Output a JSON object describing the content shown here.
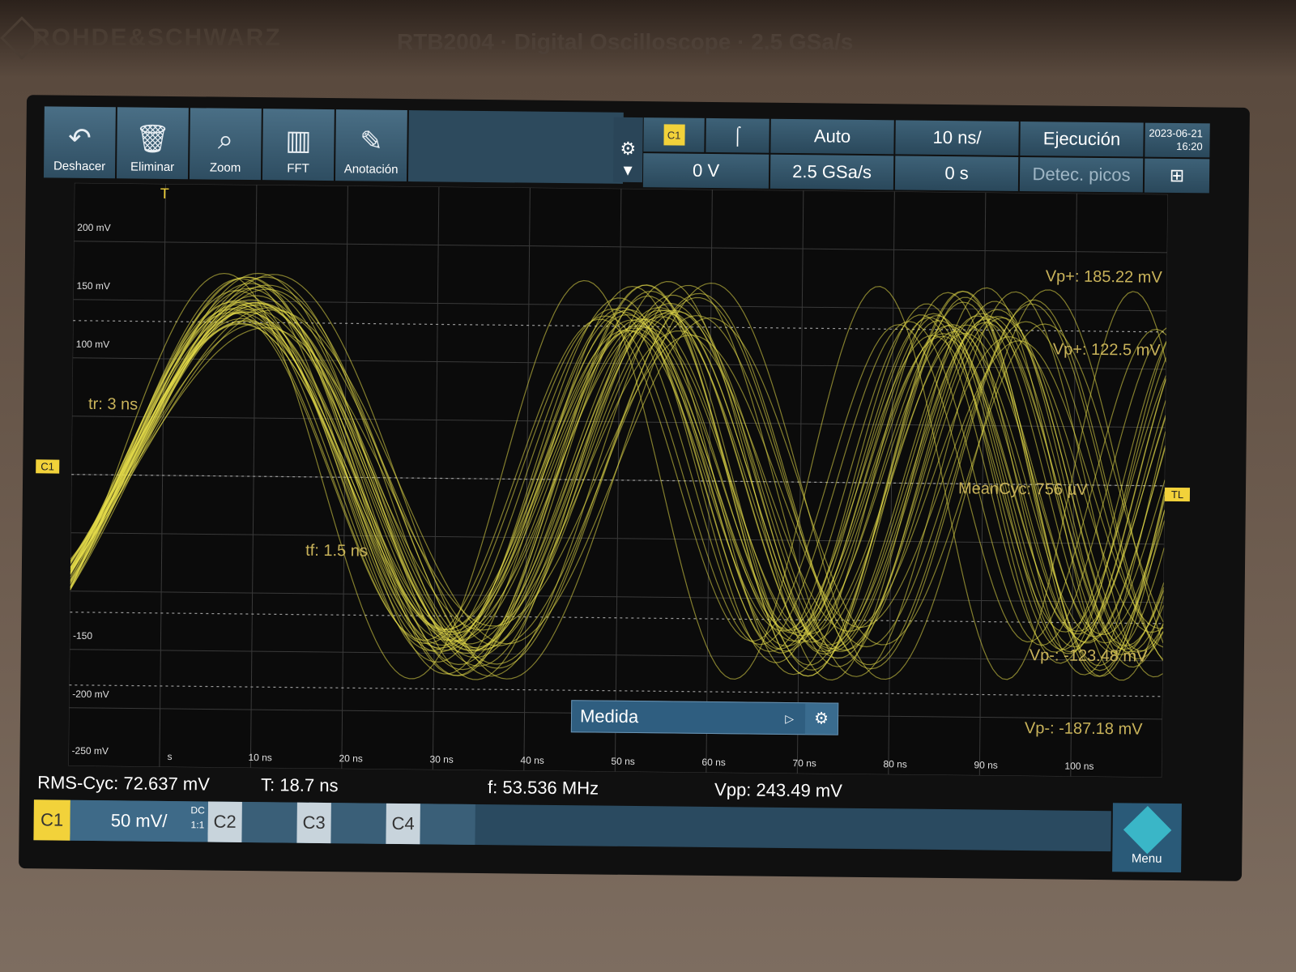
{
  "housing": {
    "brand": "ROHDE&SCHWARZ",
    "model": "RTB2004 · Digital Oscilloscope · 2.5 GSa/s"
  },
  "toolbar": {
    "undo_label": "Deshacer",
    "delete_label": "Eliminar",
    "zoom_label": "Zoom",
    "fft_label": "FFT",
    "annotation_label": "Anotación"
  },
  "header": {
    "trigger_source": "C1",
    "trigger_slope": "⌠",
    "trigger_mode": "Auto",
    "timebase": "10 ns/",
    "run_state": "Ejecución",
    "trigger_level": "0 V",
    "sample_rate": "2.5 GSa/s",
    "horizontal_position": "0 s",
    "acquisition_mode": "Detec. picos",
    "date": "2023-06-21",
    "time": "16:20"
  },
  "plot": {
    "y_labels": [
      "200 mV",
      "150 mV",
      "100 mV",
      "-150",
      "-200 mV",
      "-250 mV"
    ],
    "x_labels": [
      "s",
      "10 ns",
      "20 ns",
      "30 ns",
      "40 ns",
      "50 ns",
      "60 ns",
      "70 ns",
      "80 ns",
      "90 ns",
      "100 ns"
    ],
    "channel_marker": "C1",
    "trigger_level_marker": "TL",
    "trigger_position_marker": "T",
    "annotations": {
      "rise_time": "tr: 3 ns",
      "fall_time": "tf: 1.5 ns",
      "vp_plus_1": "Vp+: 185.22 mV",
      "vp_plus_2": "Vp+: 122.5 mV",
      "mean_cyc": "MeanCyc: 756 µV",
      "vp_minus_1": "Vp-: -123.48 mV",
      "vp_minus_2": "Vp-: -187.18 mV"
    },
    "waveform_color": "#e8df4a"
  },
  "medida": {
    "label": "Medida"
  },
  "measurements": {
    "rms_cyc": "RMS-Cyc: 72.637 mV",
    "period": "T: 18.7 ns",
    "frequency": "f: 53.536 MHz",
    "vpp": "Vpp: 243.49 mV"
  },
  "channels": {
    "c1_label": "C1",
    "c1_scale": "50 mV/",
    "c1_coupling": "DC",
    "c1_probe": "1:1",
    "c2_label": "C2",
    "c3_label": "C3",
    "c4_label": "C4",
    "menu_label": "Menu"
  }
}
